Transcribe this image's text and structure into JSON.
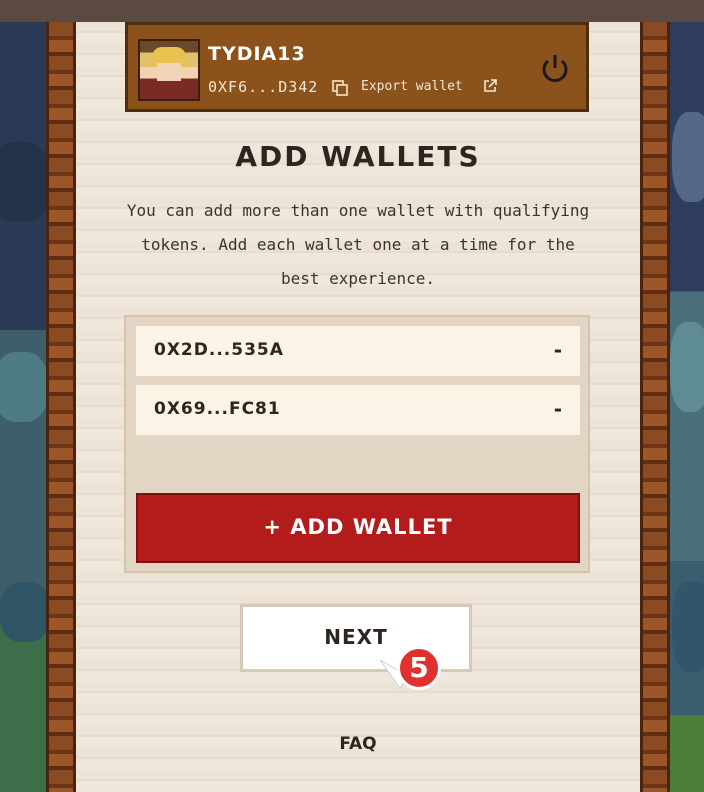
{
  "header": {
    "username": "TYDIA13",
    "address": "0XF6...D342",
    "export_label": "Export wallet"
  },
  "main": {
    "title": "ADD WALLETS",
    "description": "You can add more than one wallet with qualifying tokens. Add each wallet one at a time for the best experience.",
    "wallets": [
      {
        "address": "0X2D...535A",
        "remove_label": "-"
      },
      {
        "address": "0X69...FC81",
        "remove_label": "-"
      }
    ],
    "add_wallet_label": "+ ADD WALLET",
    "next_label": "NEXT",
    "faq_label": "FAQ"
  },
  "annotation": {
    "step_number": "5",
    "color": "#e0312f"
  },
  "colors": {
    "header_bg": "#8c521c",
    "add_button": "#b41c1c",
    "parchment": "#ece3d6"
  },
  "icons": [
    "copy-icon",
    "external-link-icon",
    "power-icon"
  ]
}
